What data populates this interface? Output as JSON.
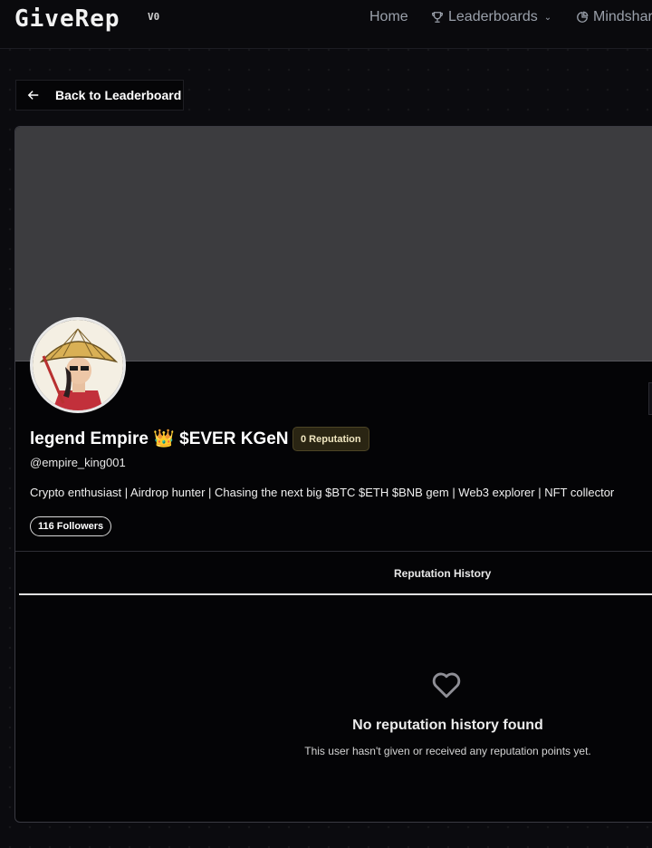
{
  "nav": {
    "logo": "GiveRep",
    "version": "V0",
    "home": "Home",
    "leaderboards": "Leaderboards",
    "mindshare": "Mindshare"
  },
  "back_label": "Back to Leaderboard",
  "profile": {
    "name": "legend Empire 👑 $EVER KGeN",
    "reputation": "0 Reputation",
    "handle": "@empire_king001",
    "bio": "Crypto enthusiast | Airdrop hunter | Chasing the next big $BTC $ETH $BNB gem | Web3 explorer | NFT collector",
    "followers": "116 Followers"
  },
  "tabs": {
    "reputation_history": "Reputation History"
  },
  "empty": {
    "title": "No reputation history found",
    "description": "This user hasn't given or received any reputation points yet."
  },
  "icons": {
    "leaderboards": "trophy-icon",
    "mindshare": "pie-chart-icon",
    "back": "arrow-left-icon",
    "empty": "heart-icon"
  }
}
